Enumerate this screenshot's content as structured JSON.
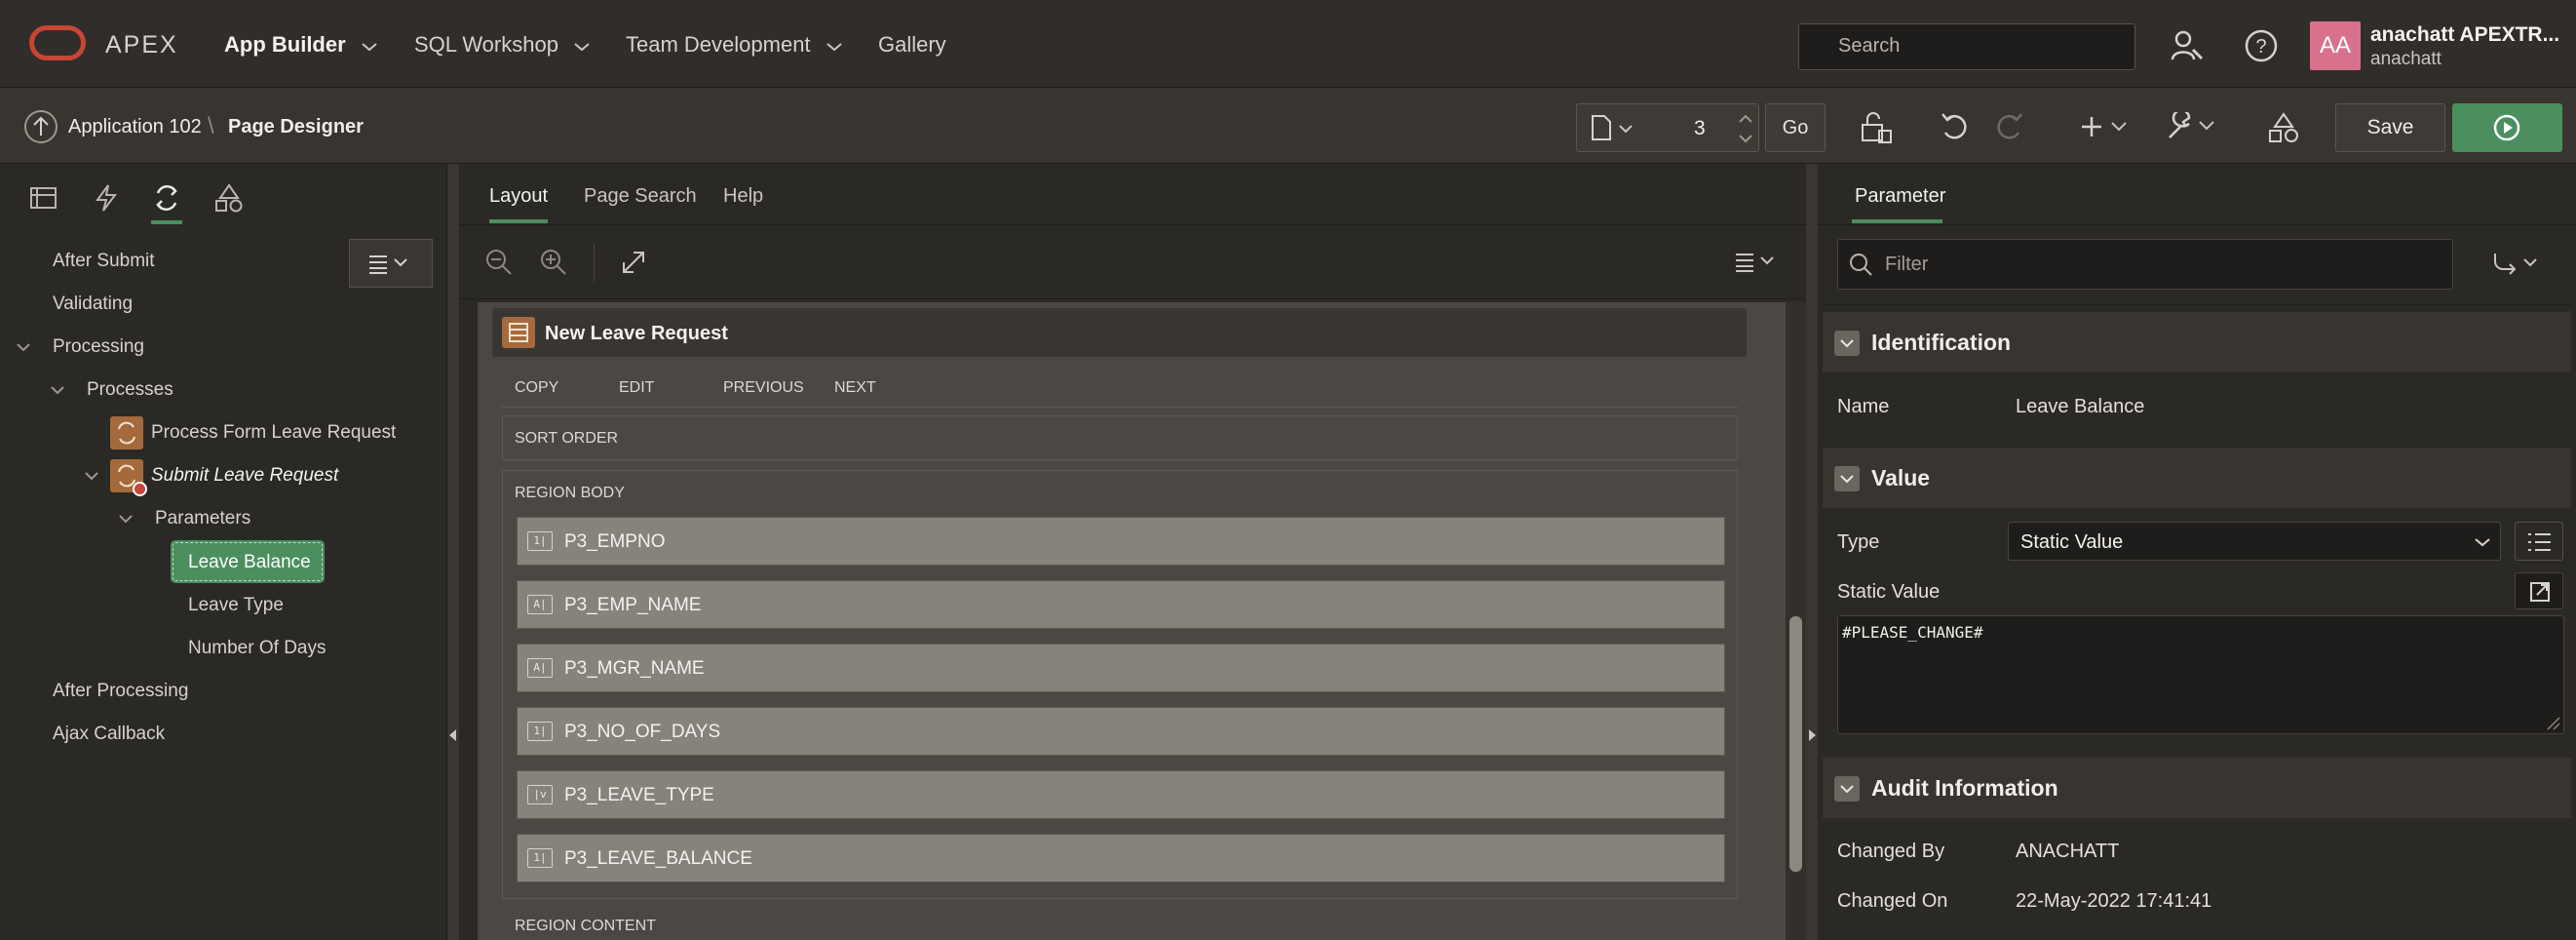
{
  "topnav": {
    "brand": "APEX",
    "menus": [
      "App Builder",
      "SQL Workshop",
      "Team Development",
      "Gallery"
    ],
    "search_placeholder": "Search",
    "user_initials": "AA",
    "user_name": "anachatt APEXTR...",
    "user_workspace": "anachatt"
  },
  "toolbar": {
    "app_label": "Application 102",
    "page_label": "Page Designer",
    "page_number": "3",
    "go_label": "Go",
    "save_label": "Save"
  },
  "left": {
    "tree": [
      {
        "label": "After Submit",
        "level": 0
      },
      {
        "label": "Validating",
        "level": 0
      },
      {
        "label": "Processing",
        "level": 0
      },
      {
        "label": "Processes",
        "level": 1
      },
      {
        "label": "Process Form Leave Request",
        "level": 2
      },
      {
        "label": "Submit Leave Request",
        "level": 2
      },
      {
        "label": "Parameters",
        "level": 3
      },
      {
        "label": "Leave Balance",
        "level": 4
      },
      {
        "label": "Leave Type",
        "level": 4
      },
      {
        "label": "Number Of Days",
        "level": 4
      },
      {
        "label": "After Processing",
        "level": 0
      },
      {
        "label": "Ajax Callback",
        "level": 0
      }
    ]
  },
  "center": {
    "tabs": [
      "Layout",
      "Page Search",
      "Help"
    ],
    "region_title": "New Leave Request",
    "buttons": [
      "COPY",
      "EDIT",
      "PREVIOUS",
      "NEXT"
    ],
    "sort_order": "SORT ORDER",
    "region_body": "REGION BODY",
    "items": [
      {
        "name": "P3_EMPNO",
        "icon": "1|"
      },
      {
        "name": "P3_EMP_NAME",
        "icon": "A|"
      },
      {
        "name": "P3_MGR_NAME",
        "icon": "A|"
      },
      {
        "name": "P3_NO_OF_DAYS",
        "icon": "1|"
      },
      {
        "name": "P3_LEAVE_TYPE",
        "icon": "|v"
      },
      {
        "name": "P3_LEAVE_BALANCE",
        "icon": "1|"
      }
    ],
    "region_content": "REGION CONTENT"
  },
  "right": {
    "tab": "Parameter",
    "filter_placeholder": "Filter",
    "identification": {
      "title": "Identification",
      "name_label": "Name",
      "name_value": "Leave Balance"
    },
    "value": {
      "title": "Value",
      "type_label": "Type",
      "type_value": "Static Value",
      "static_label": "Static Value",
      "static_value": "#PLEASE_CHANGE#"
    },
    "audit": {
      "title": "Audit Information",
      "changed_by_label": "Changed By",
      "changed_by_value": "ANACHATT",
      "changed_on_label": "Changed On",
      "changed_on_value": "22-May-2022 17:41:41"
    }
  },
  "colors": {
    "accent_green": "#4b8f5f",
    "oracle_red": "#c74634",
    "avatar_pink": "#d9718d"
  }
}
